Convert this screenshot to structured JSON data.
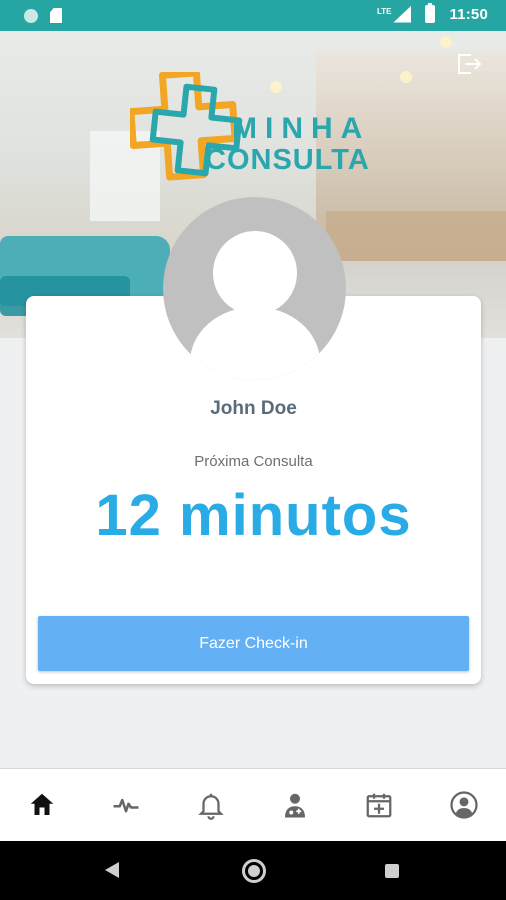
{
  "status_bar": {
    "time": "11:50",
    "network": "LTE",
    "icons": [
      "notification-dot-icon",
      "sd-card-icon",
      "signal-icon",
      "battery-icon"
    ],
    "color": "#26a6a2"
  },
  "header": {
    "logo_word_1": "MINHA",
    "logo_word_2": "CONSULTA",
    "logo_colors": {
      "orange": "#f2a623",
      "teal": "#2aa6ad"
    },
    "logout_icon": "logout-icon"
  },
  "card": {
    "user_name": "John Doe",
    "next_label": "Próxima Consulta",
    "countdown": "12 minutos",
    "checkin_label": "Fazer Check-in",
    "accent": "#29abe6",
    "button_color": "#64b0f5"
  },
  "bottom_nav": {
    "items": [
      {
        "name": "home",
        "icon": "home-icon",
        "active": true
      },
      {
        "name": "vitals",
        "icon": "pulse-icon",
        "active": false
      },
      {
        "name": "notifications",
        "icon": "bell-icon",
        "active": false
      },
      {
        "name": "doctors",
        "icon": "doctor-icon",
        "active": false
      },
      {
        "name": "schedule",
        "icon": "calendar-plus-icon",
        "active": false
      },
      {
        "name": "profile",
        "icon": "account-circle-icon",
        "active": false
      }
    ]
  },
  "system_nav": [
    "back-icon",
    "home-button-icon",
    "recents-icon"
  ]
}
